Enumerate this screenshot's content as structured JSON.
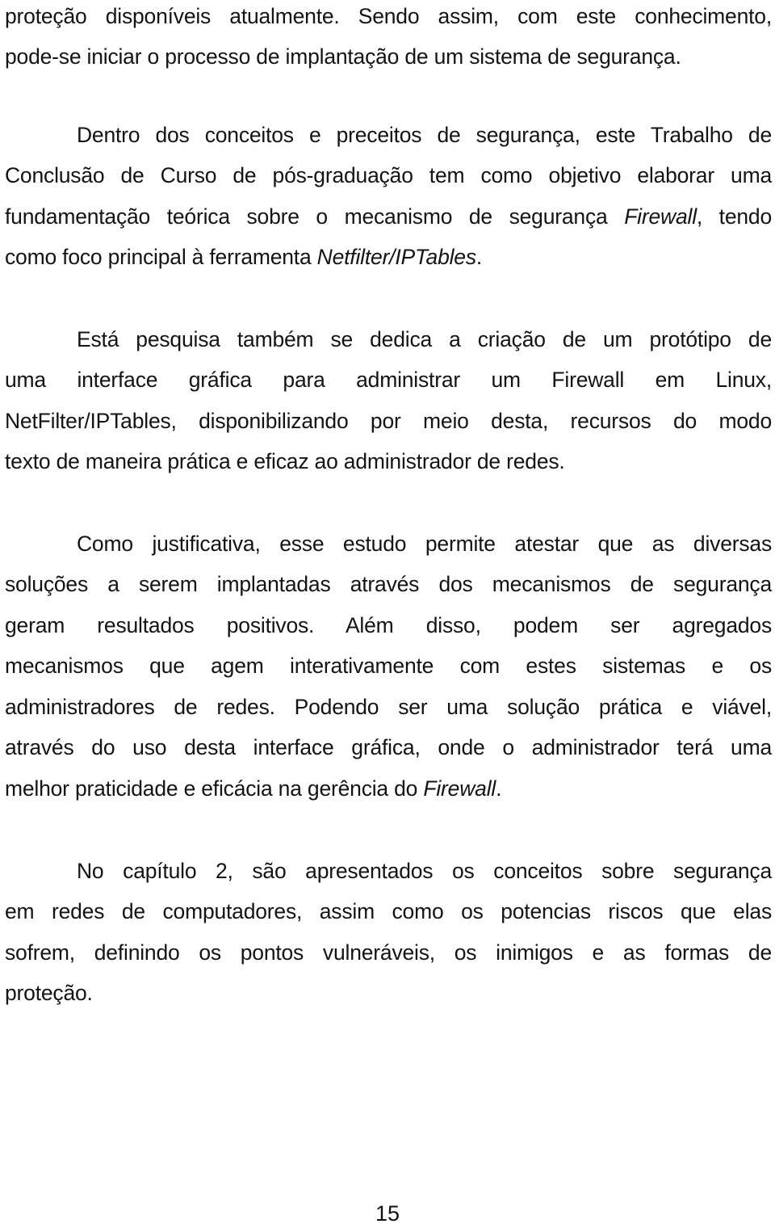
{
  "document": {
    "language": "pt-BR",
    "paragraphs": [
      {
        "id": "p0",
        "indent": false,
        "lines": [
          [
            {
              "t": "proteção disponíveis atualmente. Sendo assim, com este conhecimento,"
            }
          ],
          [
            {
              "t": "pode-se iniciar o processo de implantação de um sistema de segurança."
            }
          ]
        ]
      },
      {
        "id": "p1",
        "indent": true,
        "lines": [
          [
            {
              "t": "Dentro dos conceitos e preceitos de segurança, este Trabalho de"
            }
          ],
          [
            {
              "t": "Conclusão de Curso de pós-graduação tem como objetivo elaborar uma"
            }
          ],
          [
            {
              "t": "fundamentação teórica sobre o mecanismo de segurança "
            },
            {
              "t": "Firewall",
              "i": true
            },
            {
              "t": ", tendo"
            }
          ],
          [
            {
              "t": "como foco principal à ferramenta "
            },
            {
              "t": "Netfilter/IPTables",
              "i": true
            },
            {
              "t": "."
            }
          ]
        ]
      },
      {
        "id": "p2",
        "indent": true,
        "lines": [
          [
            {
              "t": "Está pesquisa também se dedica a criação de um protótipo de"
            }
          ],
          [
            {
              "t": "uma interface gráfica para administrar um Firewall em Linux,"
            }
          ],
          [
            {
              "t": "NetFilter/IPTables, disponibilizando por meio desta, recursos do modo"
            }
          ],
          [
            {
              "t": "texto de maneira prática e eficaz ao administrador de redes."
            }
          ]
        ]
      },
      {
        "id": "p3",
        "indent": true,
        "lines": [
          [
            {
              "t": "Como justificativa, esse estudo permite atestar que as diversas"
            }
          ],
          [
            {
              "t": "soluções a serem implantadas através dos mecanismos de segurança"
            }
          ],
          [
            {
              "t": "geram resultados positivos.  Além disso, podem ser agregados"
            }
          ],
          [
            {
              "t": "mecanismos que agem interativamente com estes sistemas e os"
            }
          ],
          [
            {
              "t": "administradores de redes. Podendo ser uma solução prática e viável,"
            }
          ],
          [
            {
              "t": "através do uso desta interface gráfica, onde o administrador terá uma"
            }
          ],
          [
            {
              "t": "melhor praticidade e eficácia na gerência do "
            },
            {
              "t": "Firewall",
              "i": true
            },
            {
              "t": "."
            }
          ]
        ]
      },
      {
        "id": "p4",
        "indent": true,
        "lines": [
          [
            {
              "t": "No capítulo 2, são apresentados os conceitos sobre segurança"
            }
          ],
          [
            {
              "t": "em redes de computadores, assim como os potencias riscos que elas"
            }
          ],
          [
            {
              "t": "sofrem, definindo os pontos vulneráveis, os inimigos e as formas de"
            }
          ],
          [
            {
              "t": "proteção."
            }
          ]
        ]
      }
    ],
    "page_number": "15"
  }
}
